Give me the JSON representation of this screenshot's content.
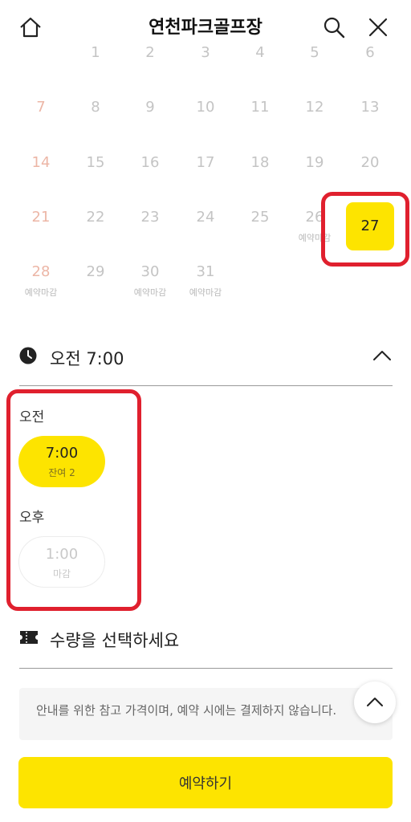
{
  "header": {
    "title": "연천파크골프장",
    "home_icon": "home-icon",
    "search_icon": "search-icon",
    "close_icon": "close-icon"
  },
  "calendar": {
    "rows": [
      [
        {
          "day": ""
        },
        {
          "day": "1"
        },
        {
          "day": "2"
        },
        {
          "day": "3"
        },
        {
          "day": "4"
        },
        {
          "day": "5"
        },
        {
          "day": "6"
        }
      ],
      [
        {
          "day": "7"
        },
        {
          "day": "8"
        },
        {
          "day": "9"
        },
        {
          "day": "10"
        },
        {
          "day": "11"
        },
        {
          "day": "12"
        },
        {
          "day": "13"
        }
      ],
      [
        {
          "day": "14"
        },
        {
          "day": "15"
        },
        {
          "day": "16"
        },
        {
          "day": "17"
        },
        {
          "day": "18"
        },
        {
          "day": "19"
        },
        {
          "day": "20"
        }
      ],
      [
        {
          "day": "21"
        },
        {
          "day": "22"
        },
        {
          "day": "23"
        },
        {
          "day": "24"
        },
        {
          "day": "25"
        },
        {
          "day": "26",
          "note": "예약마감"
        },
        {
          "day": "27",
          "selected": true
        }
      ],
      [
        {
          "day": "28",
          "note": "예약마감"
        },
        {
          "day": "29"
        },
        {
          "day": "30",
          "note": "예약마감"
        },
        {
          "day": "31",
          "note": "예약마감"
        },
        {
          "day": ""
        },
        {
          "day": ""
        },
        {
          "day": ""
        }
      ]
    ]
  },
  "time_section": {
    "selected_label": "오전 7:00",
    "am_label": "오전",
    "pm_label": "오후",
    "am_slots": [
      {
        "time": "7:00",
        "status": "잔여 2"
      }
    ],
    "pm_slots": [
      {
        "time": "1:00",
        "status": "마감"
      }
    ]
  },
  "quantity": {
    "label": "수량을 선택하세요"
  },
  "notice": {
    "text": "안내를 위한 참고 가격이며, 예약 시에는 결제하지 않습니다."
  },
  "reserve_button": {
    "label": "예약하기"
  },
  "colors": {
    "accent": "#fde400",
    "highlight": "#e0202e",
    "sunday": "#ecb6a6",
    "muted": "#c4c4c4"
  }
}
